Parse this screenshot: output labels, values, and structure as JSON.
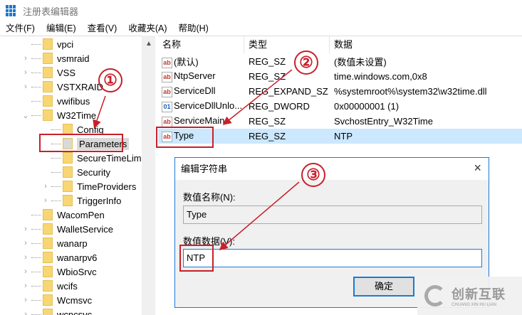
{
  "window": {
    "title": "注册表编辑器"
  },
  "menu": [
    "文件(F)",
    "编辑(E)",
    "查看(V)",
    "收藏夹(A)",
    "帮助(H)"
  ],
  "tree": [
    {
      "label": "vpci",
      "expand": false,
      "level": 1
    },
    {
      "label": "vsmraid",
      "expand": true,
      "level": 1
    },
    {
      "label": "VSS",
      "expand": true,
      "level": 1
    },
    {
      "label": "VSTXRAID",
      "expand": true,
      "level": 1
    },
    {
      "label": "vwifibus",
      "expand": false,
      "level": 1
    },
    {
      "label": "W32Time",
      "expanded": true,
      "level": 1
    },
    {
      "label": "Config",
      "level": 2
    },
    {
      "label": "Parameters",
      "level": 2,
      "selected": true
    },
    {
      "label": "SecureTimeLimits",
      "level": 2
    },
    {
      "label": "Security",
      "level": 2
    },
    {
      "label": "TimeProviders",
      "level": 2,
      "expand": true
    },
    {
      "label": "TriggerInfo",
      "level": 2,
      "expand": true
    },
    {
      "label": "WacomPen",
      "level": 1
    },
    {
      "label": "WalletService",
      "level": 1,
      "expand": true
    },
    {
      "label": "wanarp",
      "level": 1,
      "expand": true
    },
    {
      "label": "wanarpv6",
      "level": 1,
      "expand": true
    },
    {
      "label": "WbioSrvc",
      "level": 1,
      "expand": true
    },
    {
      "label": "wcifs",
      "level": 1,
      "expand": true
    },
    {
      "label": "Wcmsvc",
      "level": 1,
      "expand": true
    },
    {
      "label": "wcncsvc",
      "level": 1,
      "expand": true
    }
  ],
  "list": {
    "headers": [
      "名称",
      "类型",
      "数据"
    ],
    "rows": [
      {
        "icon": "ab",
        "name": "(默认)",
        "type": "REG_SZ",
        "data": "(数值未设置)"
      },
      {
        "icon": "ab",
        "name": "NtpServer",
        "type": "REG_SZ",
        "data": "time.windows.com,0x8"
      },
      {
        "icon": "ab",
        "name": "ServiceDll",
        "type": "REG_EXPAND_SZ",
        "data": "%systemroot%\\system32\\w32time.dll"
      },
      {
        "icon": "bin",
        "name": "ServiceDllUnlo...",
        "type": "REG_DWORD",
        "data": "0x00000001 (1)"
      },
      {
        "icon": "ab",
        "name": "ServiceMain",
        "type": "REG_SZ",
        "data": "SvchostEntry_W32Time"
      },
      {
        "icon": "ab",
        "name": "Type",
        "type": "REG_SZ",
        "data": "NTP",
        "highlighted": true
      }
    ]
  },
  "dialog": {
    "title": "编辑字符串",
    "name_label": "数值名称(N):",
    "name_value": "Type",
    "data_label": "数值数据(V):",
    "data_value": "NTP",
    "ok": "确定",
    "close": "×"
  },
  "annotations": {
    "one": "①",
    "two": "②",
    "three": "③",
    "color": "#c8202a"
  },
  "watermark": {
    "text": "创新互联",
    "sub": "CHUANG XIN HU LIAN"
  }
}
